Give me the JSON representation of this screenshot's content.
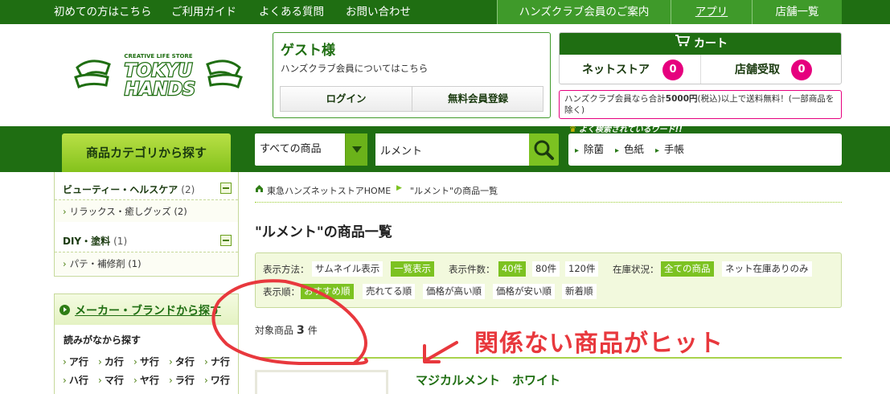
{
  "topnav": {
    "items": [
      "初めての方はこちら",
      "ご利用ガイド",
      "よくある質問",
      "お問い合わせ"
    ],
    "right": [
      "ハンズクラブ会員のご案内",
      "アプリ",
      "店舗一覧"
    ]
  },
  "logo": {
    "tagline": "CREATIVE LIFE STORE",
    "line1": "TOKYU",
    "line2": "HANDS"
  },
  "guest": {
    "name": "ゲスト様",
    "info_link": "ハンズクラブ会員についてはこちら",
    "login_label": "ログイン",
    "register_label": "無料会員登録"
  },
  "cart": {
    "title": "カート",
    "netstore_label": "ネットストア",
    "netstore_count": "0",
    "pickup_label": "店舗受取",
    "pickup_count": "0"
  },
  "shipping_note": {
    "prefix": "ハンズクラブ会員なら合計",
    "amount": "5000円",
    "suffix": "(税込)以上で送料無料！(一部商品を除く)"
  },
  "search": {
    "category_button": "商品カテゴリから探す",
    "scope": "すべての商品",
    "query": "ルメント",
    "popular_title": "よく検索されているワード!!",
    "popular": [
      "除菌",
      "色紙",
      "手帳"
    ]
  },
  "sidebar": {
    "categories": [
      {
        "name": "ビューティー・ヘルスケア",
        "count": "(2)",
        "sub": "リラックス・癒しグッズ (2)"
      },
      {
        "name": "DIY・塗料",
        "count": "(1)",
        "sub": "パテ・補修剤 (1)"
      }
    ],
    "maker_title": "メーカー・ブランドから探す",
    "maker_subtitle": "読みがなから探す",
    "kana": [
      "ア行",
      "カ行",
      "サ行",
      "タ行",
      "ナ行",
      "ハ行",
      "マ行",
      "ヤ行",
      "ラ行",
      "ワ行"
    ]
  },
  "breadcrumb": [
    "東急ハンズネットストアHOME",
    "\"ルメント\"の商品一覧"
  ],
  "page_title": "\"ルメント\"の商品一覧",
  "filters": {
    "view_label": "表示方法：",
    "view_options": [
      "サムネイル表示",
      "一覧表示"
    ],
    "count_label": "表示件数：",
    "count_options": [
      "40件",
      "80件",
      "120件"
    ],
    "stock_label": "在庫状況：",
    "stock_options": [
      "全ての商品",
      "ネット在庫ありのみ"
    ],
    "sort_label": "表示順：",
    "sort_options": [
      "おすすめ順",
      "売れてる順",
      "価格が高い順",
      "価格が安い順",
      "新着順"
    ]
  },
  "results": {
    "label": "対象商品",
    "count": "3",
    "unit": "件"
  },
  "annotation": "関係ない商品がヒット",
  "first_product": "マジカルメント　ホワイト",
  "colors": {
    "dark_green": "#1f6e12",
    "accent_green": "#7cc221",
    "badge_pink": "#e6007e",
    "annotation_red": "#e8383d"
  }
}
